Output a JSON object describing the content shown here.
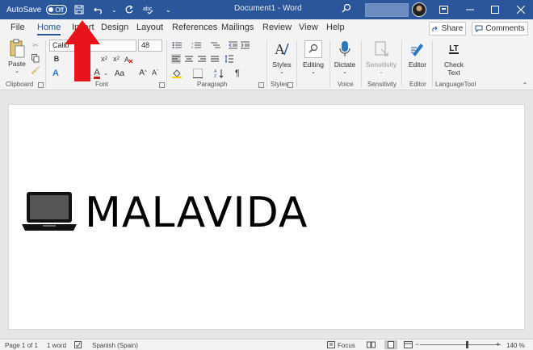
{
  "titlebar": {
    "autosave_label": "AutoSave",
    "autosave_state": "Off",
    "document_title": "Document1  -  Word",
    "window_controls": [
      "ribbon-display-icon",
      "minimize-icon",
      "maximize-icon",
      "close-icon"
    ]
  },
  "tabs": [
    {
      "label": "File",
      "active": false
    },
    {
      "label": "Home",
      "active": true
    },
    {
      "label": "Insert",
      "active": false
    },
    {
      "label": "Design",
      "active": false
    },
    {
      "label": "Layout",
      "active": false
    },
    {
      "label": "References",
      "active": false
    },
    {
      "label": "Mailings",
      "active": false
    },
    {
      "label": "Review",
      "active": false
    },
    {
      "label": "View",
      "active": false
    },
    {
      "label": "Help",
      "active": false
    }
  ],
  "share_label": "Share",
  "comments_label": "Comments",
  "ribbon": {
    "clipboard": {
      "paste": "Paste",
      "label": "Clipboard"
    },
    "font": {
      "name": "Calib",
      "size": "48",
      "label": "Font",
      "bold": "B",
      "aa_label": "Aa",
      "a_label": "A"
    },
    "paragraph": {
      "label": "Paragraph",
      "pilcrow": "¶"
    },
    "styles": {
      "button": "Styles",
      "label": "Styles"
    },
    "editing": {
      "button": "Editing"
    },
    "voice": {
      "button": "Dictate",
      "label": "Voice"
    },
    "sensitivity": {
      "button": "Sensitivity",
      "label": "Sensitivity"
    },
    "editor": {
      "button": "Editor",
      "label": "Editor"
    },
    "languagetool": {
      "button_line1": "Check",
      "button_line2": "Text",
      "label": "LanguageTool",
      "logo": "LT"
    }
  },
  "document": {
    "text": "MALAVIDA"
  },
  "status": {
    "page": "Page 1 of 1",
    "words": "1 word",
    "language": "Spanish (Spain)",
    "focus": "Focus",
    "zoom": "140 %",
    "zoom_minus": "−",
    "zoom_plus": "+"
  },
  "colors": {
    "accent": "#2b579a",
    "arrow": "#e8141c"
  }
}
